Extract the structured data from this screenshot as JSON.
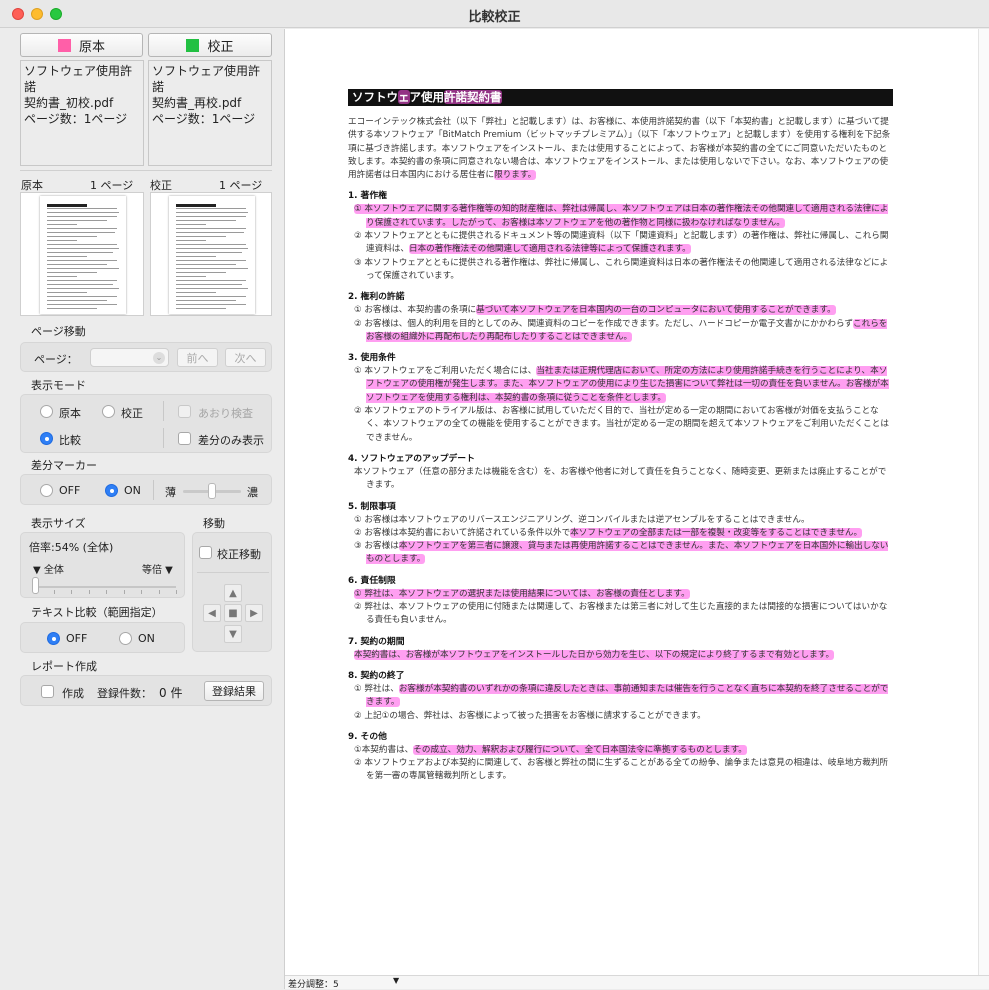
{
  "window": {
    "title": "比較校正"
  },
  "sidebar": {
    "original_button": "原本",
    "proof_button": "校正",
    "original_color": "#ff5fa8",
    "proof_color": "#22c042",
    "original_file": "ソフトウェア使用許諾\n契約書_初校.pdf\nページ数：1ページ",
    "proof_file": "ソフトウェア使用許諾\n契約書_再校.pdf\nページ数：1ページ",
    "original_header": "原本",
    "original_page": "1 ページ",
    "proof_header": "校正",
    "proof_page": "1 ページ",
    "page_move": {
      "title": "ページ移動",
      "page_label": "ページ：",
      "prev": "前へ",
      "next": "次へ"
    },
    "display_mode": {
      "title": "表示モード",
      "original": "原本",
      "proof": "校正",
      "flicker": "あおり検査",
      "compare": "比較",
      "diff_only": "差分のみ表示",
      "selected": "比較"
    },
    "diff_marker": {
      "title": "差分マーカー",
      "off": "OFF",
      "on": "ON",
      "light": "薄",
      "dark": "濃",
      "selected": "ON"
    },
    "display_size": {
      "title": "表示サイズ",
      "zoom": "倍率:54% (全体)",
      "fit_all": "▼ 全体",
      "actual": "等倍 ▼"
    },
    "move": {
      "title": "移動",
      "proof_move": "校正移動"
    },
    "text_compare": {
      "title": "テキスト比較（範囲指定）",
      "off": "OFF",
      "on": "ON",
      "selected": "OFF"
    },
    "report": {
      "title": "レポート作成",
      "create": "作成",
      "count_label": "登録件数：",
      "count": "0 件",
      "result_button": "登録結果"
    }
  },
  "status": {
    "diff_adjust": "差分調整：5"
  },
  "document": {
    "title_a": "ソフトウ",
    "title_b": "ェ",
    "title_c": "ア使用",
    "title_d": "許諾契約書",
    "intro": "エコーインテック株式会社（以下「弊社」と記載します）は、お客様に、本使用許諾契約書（以下「本契約書」と記載します）に基づいて提供する本ソフトウェア「BitMatch Premium（ビットマッチプレミアム）」（以下「本ソフトウェア」と記載します）を使用する権利を下記条項に基づき許諾します。本ソフトウェアをインストール、または使用することによって、お客様が本契約書の全てにご同意いただいたものと致します。本契約書の条項に同意されない場合は、本ソフトウェアをインストール、または使用しないで下さい。なお、本ソフトウェアの使用許諾者は日本国内における居住者に",
    "intro_hl": "限ります。",
    "sections": [
      {
        "heading": "1. 著作権",
        "items": [
          {
            "t": "",
            "h": "① 本ソフトウェアに関する著作権等の知的財産権は、弊社は帰属し、本ソフトウェアは日本の著作権法その他関連して適用される法律により保護されています。したがって、お客様は本ソフトウェアを他の著作物と同様に扱わなければなりません。"
          },
          {
            "t": "② 本ソフトウェアとともに提供されるドキュメント等の関連資料（以下「関連資料」と記載します）の著作権は、弊社に帰属し、これら関連資料は、",
            "h": "日本の著作権法その他関連して適用される法律等によって保護されます。"
          },
          {
            "t": "③ 本ソフトウェアとともに提供される著作権は、弊社に帰属し、これら関連資料は日本の著作権法その他関連して適用される法律などによって保護されています。",
            "h": ""
          }
        ]
      },
      {
        "heading": "2. 権利の許諾",
        "items": [
          {
            "t": "① お客様は、本契約書の条項に",
            "h": "基づいて本ソフトウェアを日本国内の一台のコンピュータにおいて使用することができます。"
          },
          {
            "t": "② お客様は、個人的利用を目的としてのみ、関連資料のコピーを作成できます。ただし、ハードコピーか電子文書かにかかわらず",
            "h": "これらをお客様の組織外に再配布したり再配布したりすることはできません。"
          }
        ]
      },
      {
        "heading": "3. 使用条件",
        "items": [
          {
            "t": "① 本ソフトウェアをご利用いただく場合には、",
            "h": "当社または正規代理店において、所定の方法により使用許諾手続きを行うことにより、本ソフトウェアの使用権が発生します。また、本ソフトウェアの使用により生じた損害について弊社は一切の責任を負いません。お客様が本ソフトウェアを使用する権利は、本契約書の条項に従うことを条件とします。"
          },
          {
            "t": "② 本ソフトウェアのトライアル版は、お客様に試用していただく目的で、当社が定める一定の期間においてお客様が対価を支払うことなく、本ソフトウェアの全ての機能を使用することができます。当社が定める一定の期間を超えて本ソフトウェアをご利用いただくことはできません。",
            "h": ""
          }
        ]
      },
      {
        "heading": "4. ソフトウェアのアップデート",
        "items": [
          {
            "t": "本ソフトウェア（任意の部分または機能を含む）を、お客様や他者に対して責任を負うことなく、随時変更、更新または廃止することができます。",
            "h": ""
          }
        ]
      },
      {
        "heading": "5. 制限事項",
        "items": [
          {
            "t": "① お客様は本ソフトウェアのリバースエンジニアリング、逆コンパイルまたは逆アセンブルをすることはできません。",
            "h": ""
          },
          {
            "t": "② お客様は本契約書において許諾されている条件以外で",
            "h": "本ソフトウェアの全部または一部を複製・改変等をすることはできません。"
          },
          {
            "t": "③ お客様は",
            "h": "本ソフトウェアを第三者に譲渡、貸与または再使用許諾することはできません。また、本ソフトウェアを日本国外に輸出しないものとします。"
          }
        ]
      },
      {
        "heading": "6. 責任制限",
        "items": [
          {
            "t": "",
            "h": "① 弊社は、本ソフトウェアの選択または使用結果については、お客様の責任とします。"
          },
          {
            "t": "② 弊社は、本ソフトウェアの使用に付随または関連して、お客様または第三者に対して生じた直接的または間接的な損害についてはいかなる責任も負いません。",
            "h": ""
          }
        ]
      },
      {
        "heading": "7. 契約の期間",
        "items": [
          {
            "t": "",
            "h": "本契約書は、お客様が本ソフトウェアをインストールした日から効力を生じ、以下の規定により終了するまで有効とします。"
          }
        ]
      },
      {
        "heading": "8. 契約の終了",
        "items": [
          {
            "t": "① 弊社は、",
            "h": "お客様が本契約書のいずれかの条項に違反したときは、事前通知または催告を行うことなく直ちに本契約を終了させることができます。"
          },
          {
            "t": "② 上記①の場合、弊社は、お客様によって被った損害をお客様に請求することができます。",
            "h": ""
          }
        ]
      },
      {
        "heading": "9. その他",
        "items": [
          {
            "t": "①本契約書は、",
            "h": "その成立、効力、解釈および履行について、全て日本国法令に準拠するものとします。"
          },
          {
            "t": "② 本ソフトウェアおよび本契約に関連して、お客様と弊社の間に生ずることがある全ての紛争、論争または意見の相違は、岐阜地方裁判所を第一審の専属管轄裁判所とします。",
            "h": ""
          }
        ]
      }
    ]
  }
}
